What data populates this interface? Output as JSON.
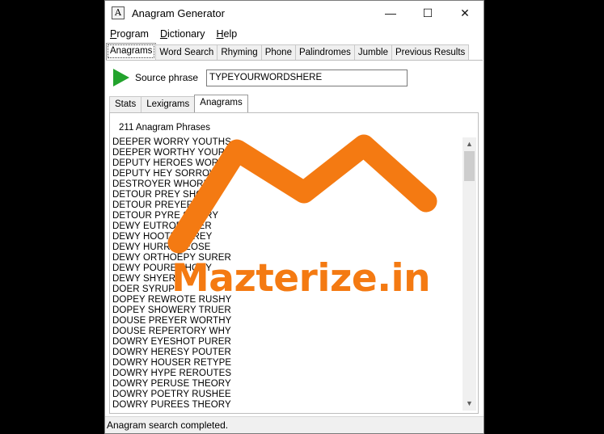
{
  "window": {
    "title": "Anagram Generator",
    "icon_letter": "A"
  },
  "controls": {
    "minimize": "—",
    "maximize": "☐",
    "close": "✕"
  },
  "menu": [
    {
      "underline": "P",
      "rest": "rogram"
    },
    {
      "underline": "D",
      "rest": "ictionary"
    },
    {
      "underline": "H",
      "rest": "elp"
    }
  ],
  "tabs": [
    "Anagrams",
    "Word Search",
    "Rhyming",
    "Phone",
    "Palindromes",
    "Jumble",
    "Previous Results"
  ],
  "source": {
    "label": "Source phrase",
    "value": "TYPEYOURWORDSHERE"
  },
  "subtabs": [
    "Stats",
    "Lexigrams",
    "Anagrams"
  ],
  "results": {
    "count_label": "211 Anagram Phrases",
    "items": [
      "DEEPER WORRY YOUTHS",
      "DEEPER WORTHY YOURS",
      "DEPUTY HEROES WORRY",
      "DEPUTY HEY SORROWE",
      "DESTROYER WHORE Y",
      "DETOUR PREY SHOW",
      "DETOUR PREYER S",
      "DETOUR PYRE SH    RRY",
      "DEWY EUTROPH     RER",
      "DEWY HOOTER     RREY",
      "DEWY HURRY    TEOSE",
      "DEWY ORTHOEPY SURER",
      "DEWY POURE      THORY",
      "DEWY SHYER",
      "DOER SYRUP",
      "DOPEY REWROTE RUSHY",
      "DOPEY SHOWERY TRUER",
      "DOUSE PREYER WORTHY",
      "DOUSE REPERTORY WHY",
      "DOWRY EYESHOT PURER",
      "DOWRY HERESY POUTER",
      "DOWRY HOUSER RETYPE",
      "DOWRY HYPE REROUTES",
      "DOWRY PERUSE THEORY",
      "DOWRY POETRY RUSHEE",
      "DOWRY PUREES THEORY"
    ]
  },
  "status": "Anagram search completed.",
  "watermark": {
    "text": "Mazterize.in",
    "color": "#f47a12"
  }
}
